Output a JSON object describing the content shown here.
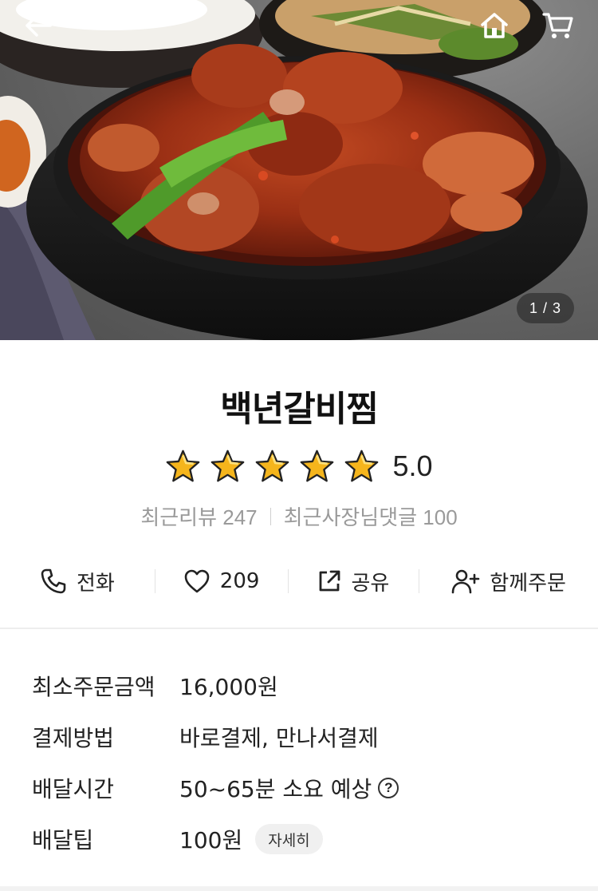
{
  "hero": {
    "page_indicator": "1 / 3",
    "icons": {
      "back": "back-arrow-icon",
      "home": "home-icon",
      "cart": "cart-icon"
    }
  },
  "store": {
    "name": "백년갈비찜",
    "rating": 5.0,
    "rating_text": "5.0",
    "recent_reviews": "최근리뷰 247",
    "owner_replies": "최근사장님댓글 100"
  },
  "actions": [
    {
      "label": "전화",
      "icon": "phone-icon"
    },
    {
      "label": "209",
      "icon": "heart-icon"
    },
    {
      "label": "공유",
      "icon": "share-icon"
    },
    {
      "label": "함께주문",
      "icon": "add-user-icon"
    }
  ],
  "info": {
    "min_order": {
      "label": "최소주문금액",
      "value": "16,000원"
    },
    "payment": {
      "label": "결제방법",
      "value": "바로결제, 만나서결제"
    },
    "delivery_time": {
      "label": "배달시간",
      "value": "50~65분 소요 예상",
      "help": "?"
    },
    "delivery_tip": {
      "label": "배달팁",
      "value": "100원",
      "detail_button": "자세히"
    }
  },
  "colors": {
    "star": "#f5b51c",
    "text": "#222222",
    "muted": "#9a9a9a"
  }
}
